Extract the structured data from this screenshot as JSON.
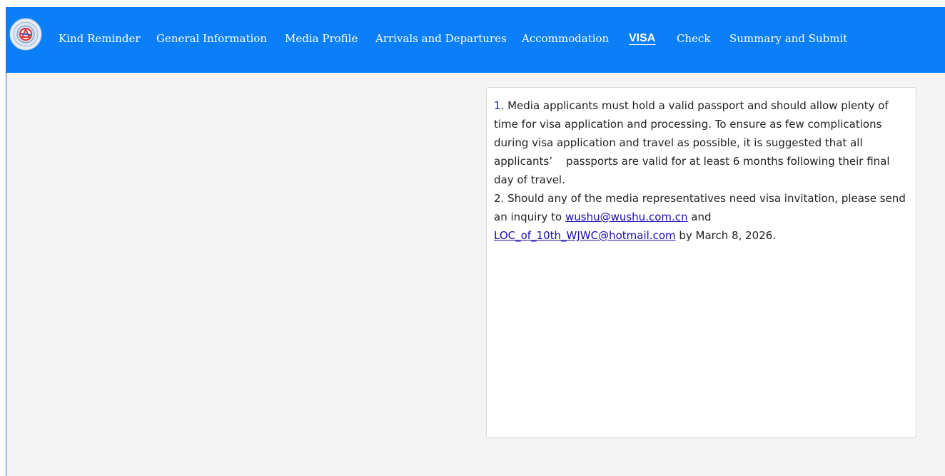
{
  "nav": {
    "logo_icon": "wushu-federation-logo-icon",
    "items": [
      {
        "label": "Kind Reminder"
      },
      {
        "label": "General Information"
      },
      {
        "label": "Media Profile"
      },
      {
        "label": "Arrivals and Departures"
      },
      {
        "label": "Accommodation"
      },
      {
        "label": "VISA"
      },
      {
        "label": "Check"
      },
      {
        "label": "Summary and Submit"
      }
    ],
    "active": "VISA"
  },
  "notice": {
    "p1_num": "1.",
    "p1_text": " Media applicants must hold a valid passport and should allow plenty of time for visa application and processing. To ensure as few complications during visa application and travel as possible, it is suggested that all applicants’    passports are valid for at least 6 months following their final day of travel.",
    "p2_num": "2.",
    "p2_pre": " Should any of the media representatives need visa invitation, please send an inquiry to ",
    "email1": "wushu@wushu.com.cn",
    "p2_and": " and ",
    "email2": "LOC_of_10th_WJWC@hotmail.com",
    "p2_post": " by March 8, 2026."
  },
  "colors": {
    "navbar": "#0a7ff7",
    "page_background": "#f4f4f4",
    "link": "#1a0dab"
  }
}
